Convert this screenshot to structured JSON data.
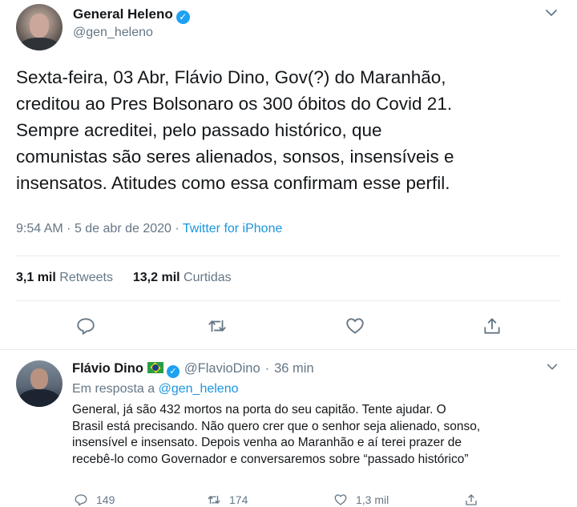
{
  "main_tweet": {
    "name": "General Heleno",
    "handle": "@gen_heleno",
    "text_lines": [
      "Sexta-feira, 03 Abr, Flávio Dino, Gov(?) do Maranhão,",
      "creditou ao Pres Bolsonaro os 300 óbitos do Covid 21.",
      "Sempre acreditei, pelo passado histórico, que",
      "comunistas são seres alienados, sonsos, insensíveis e",
      "insensatos. Atitudes como essa confirmam esse perfil."
    ],
    "time": "9:54 AM",
    "date": "5 de abr de 2020",
    "source": "Twitter for iPhone",
    "retweets_count": "3,1 mil",
    "retweets_label": "Retweets",
    "likes_count": "13,2 mil",
    "likes_label": "Curtidas"
  },
  "reply_tweet": {
    "name": "Flávio Dino",
    "handle": "@FlavioDino",
    "time": "36 min",
    "in_reply_prefix": "Em resposta a",
    "in_reply_mention": "@gen_heleno",
    "text_lines": [
      "General, já são 432 mortos na porta do seu capitão. Tente ajudar.  O",
      "Brasil está precisando. Não quero crer que o senhor seja alienado, sonso,",
      "insensível e insensato. Depois venha ao Maranhão e aí terei prazer de",
      "recebê-lo como Governador e conversaremos sobre “passado histórico”"
    ],
    "reply_count": "149",
    "retweet_count": "174",
    "like_count": "1,3 mil"
  },
  "icons": [
    "reply-icon",
    "retweet-icon",
    "like-icon",
    "share-icon",
    "verified-icon",
    "chevron-down-icon",
    "brazil-flag-icon"
  ],
  "colors": {
    "link": "#1b95e0",
    "muted": "#657786",
    "verified": "#1da1f2",
    "text": "#14171a"
  }
}
